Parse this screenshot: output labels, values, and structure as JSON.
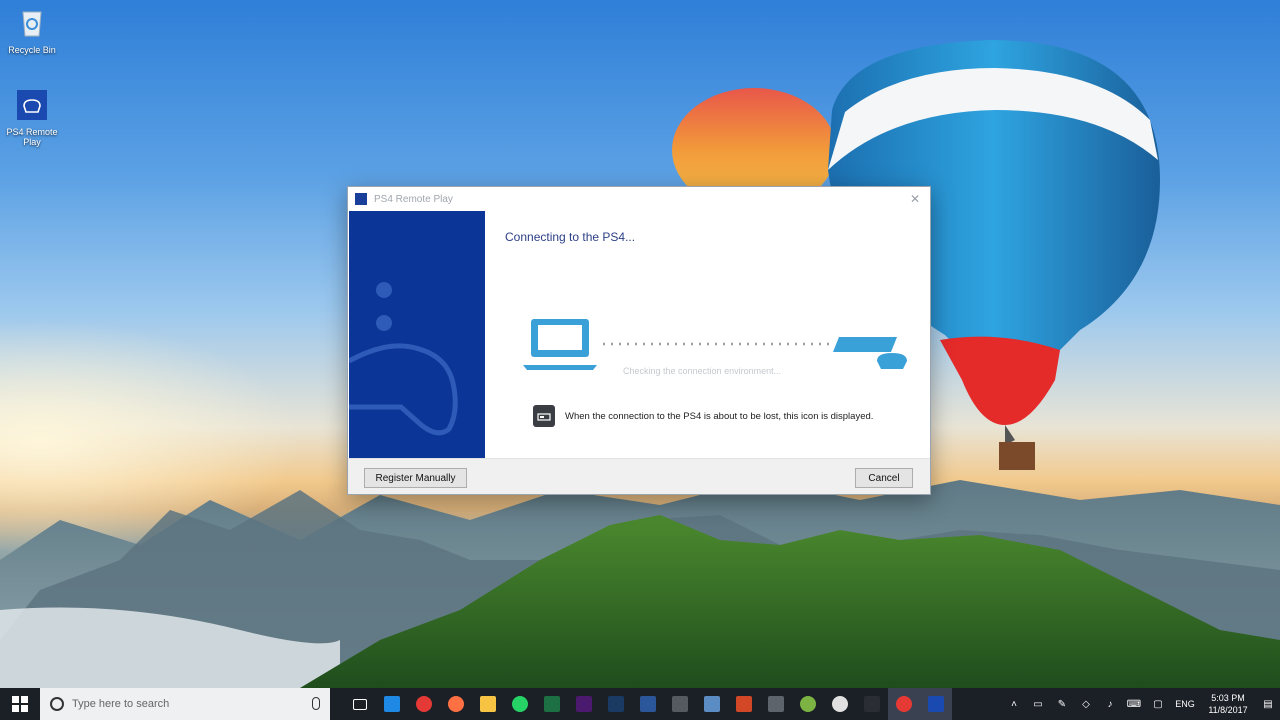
{
  "desktop": {
    "icons": [
      {
        "label": "Recycle Bin"
      },
      {
        "label": "PS4 Remote Play"
      }
    ]
  },
  "dialog": {
    "title": "PS4 Remote Play",
    "close_glyph": "✕",
    "heading": "Connecting to the PS4...",
    "status": "Checking the connection environment...",
    "hint": "When the connection to the PS4 is about to be lost, this icon is displayed.",
    "buttons": {
      "register": "Register Manually",
      "cancel": "Cancel"
    },
    "colors": {
      "side_panel": "#0b3596",
      "accent": "#3aa0d8"
    }
  },
  "taskbar": {
    "search_placeholder": "Type here to search",
    "apps": [
      {
        "name": "task-view",
        "color": "#1b1f26"
      },
      {
        "name": "edge",
        "color": "#1e88e5"
      },
      {
        "name": "chrome",
        "color": "#e53935"
      },
      {
        "name": "firefox",
        "color": "#ff7043"
      },
      {
        "name": "file-explorer",
        "color": "#f6c342"
      },
      {
        "name": "whatsapp",
        "color": "#25d366"
      },
      {
        "name": "excel",
        "color": "#1d7044"
      },
      {
        "name": "premiere",
        "color": "#4b1a6e"
      },
      {
        "name": "photoshop",
        "color": "#1b3a63"
      },
      {
        "name": "word",
        "color": "#2b579a"
      },
      {
        "name": "calculator",
        "color": "#555a60"
      },
      {
        "name": "store",
        "color": "#5b8cc4"
      },
      {
        "name": "powerpoint",
        "color": "#d24726"
      },
      {
        "name": "chart-app",
        "color": "#5d646c"
      },
      {
        "name": "green-app",
        "color": "#7cb342"
      },
      {
        "name": "maps",
        "color": "#e0e0e0"
      },
      {
        "name": "terminal",
        "color": "#2a2d33"
      },
      {
        "name": "chrome-active",
        "color": "#e53935"
      },
      {
        "name": "ps4-remote-play",
        "color": "#1a4ab0"
      }
    ],
    "tray": {
      "language": "ENG",
      "time": "5:03 PM",
      "date": "11/8/2017"
    }
  }
}
